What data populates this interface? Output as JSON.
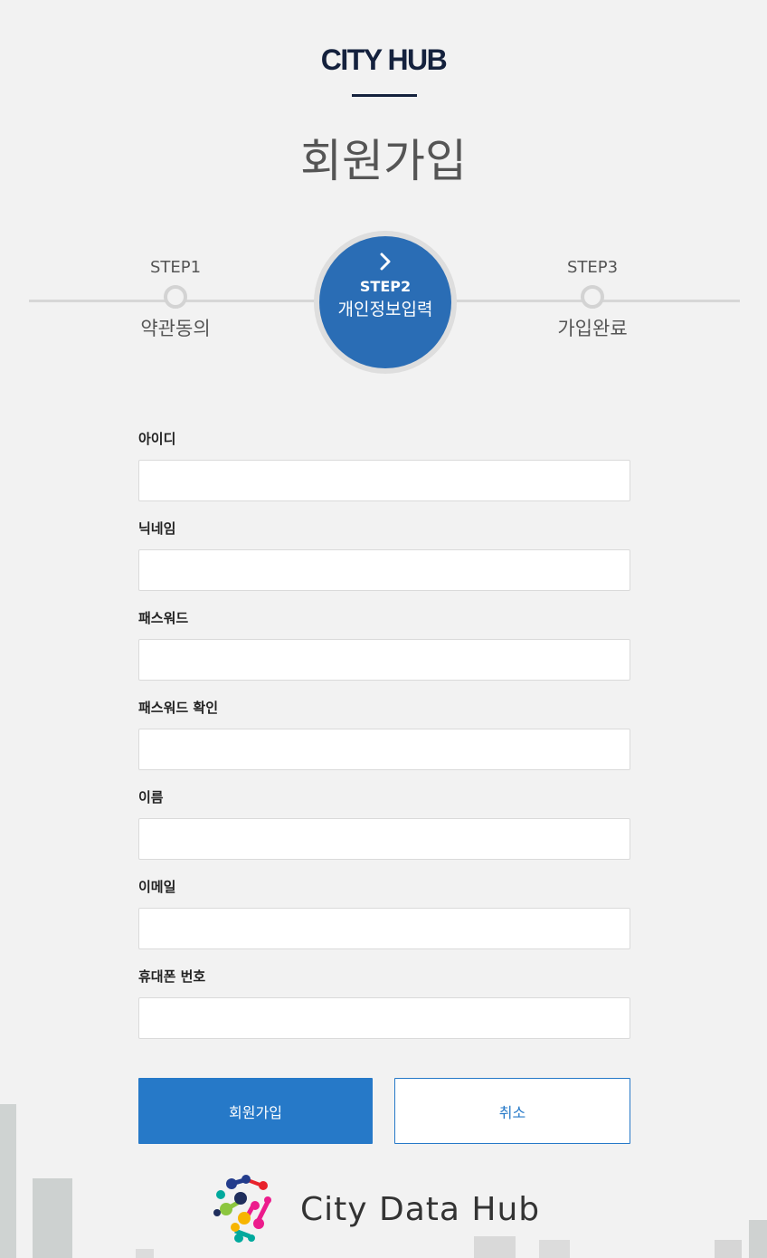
{
  "header": {
    "brand": "CITY HUB",
    "title": "회원가입"
  },
  "stepper": {
    "steps": [
      {
        "no": "STEP1",
        "label": "약관동의",
        "active": false
      },
      {
        "no": "STEP2",
        "label": "개인정보입력",
        "active": true
      },
      {
        "no": "STEP3",
        "label": "가입완료",
        "active": false
      }
    ],
    "active_indicator": "chevron-right-icon"
  },
  "form": {
    "fields": [
      {
        "label": "아이디",
        "value": "",
        "placeholder": ""
      },
      {
        "label": "닉네임",
        "value": "",
        "placeholder": ""
      },
      {
        "label": "패스워드",
        "value": "",
        "placeholder": ""
      },
      {
        "label": "패스워드 확인",
        "value": "",
        "placeholder": ""
      },
      {
        "label": "이름",
        "value": "",
        "placeholder": ""
      },
      {
        "label": "이메일",
        "value": "",
        "placeholder": ""
      },
      {
        "label": "휴대폰 번호",
        "value": "",
        "placeholder": ""
      }
    ],
    "submit_label": "회원가입",
    "cancel_label": "취소"
  },
  "footer": {
    "logo_text": "City Data Hub",
    "logo_icon": "molecule-dots-icon"
  },
  "colors": {
    "primary": "#2679c8",
    "step_active": "#2a6db5",
    "brand": "#14213d",
    "background": "#f2f2f2"
  }
}
